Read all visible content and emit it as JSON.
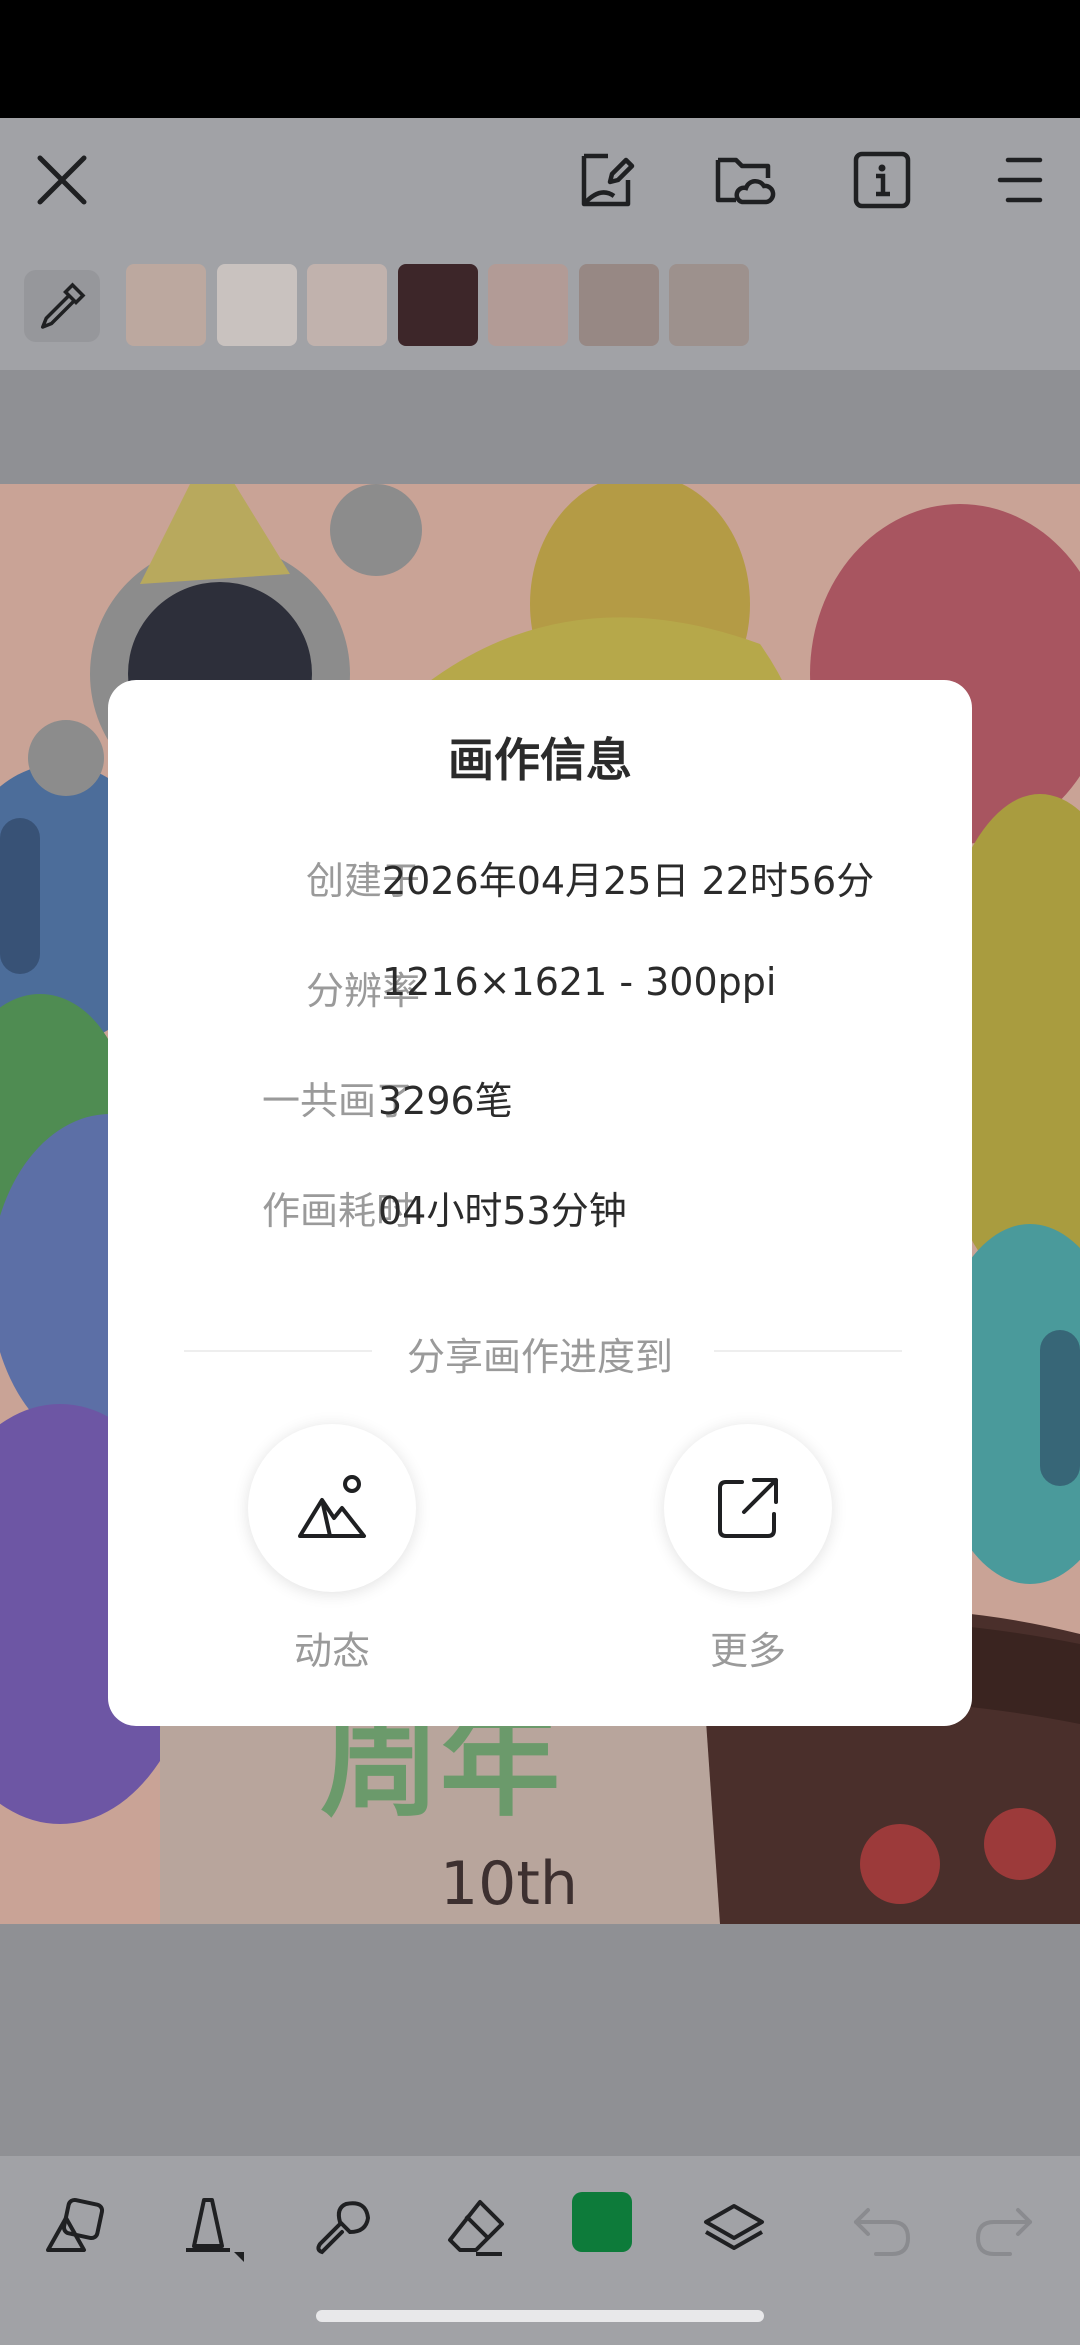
{
  "toolbar": {
    "close_icon": "close-icon",
    "icons": [
      "edit-document-icon",
      "cloud-folder-icon",
      "info-icon",
      "menu-icon"
    ]
  },
  "palette": {
    "eyedropper_icon": "eyedropper-icon",
    "swatches": [
      "#bca89f",
      "#c9c2bf",
      "#c1b2ad",
      "#3d2629",
      "#b29b96",
      "#978884",
      "#9d918d"
    ]
  },
  "dialog": {
    "title": "画作信息",
    "rows": [
      {
        "label": "创建于",
        "value": "2026年04月25日 22时56分"
      },
      {
        "label": "分辨率",
        "value": "1216×1621 - 300ppi"
      },
      {
        "label": "一共画了",
        "value": "3296笔"
      },
      {
        "label": "作画耗时",
        "value": "04小时53分钟"
      }
    ],
    "share_title": "分享画作进度到",
    "share_buttons": [
      {
        "label": "动态",
        "icon": "mountain-image-icon"
      },
      {
        "label": "更多",
        "icon": "external-share-icon"
      }
    ]
  },
  "bottom_toolbar": {
    "icons": [
      "shapes-icon",
      "fill-bucket-icon",
      "brush-icon",
      "eraser-icon",
      "current-color",
      "layers-icon",
      "undo-icon",
      "redo-icon"
    ],
    "current_color": "#0d7b3a"
  },
  "colors": {
    "overlay_toolbar": "#a1a2a6",
    "dialog_bg": "#ffffff"
  }
}
